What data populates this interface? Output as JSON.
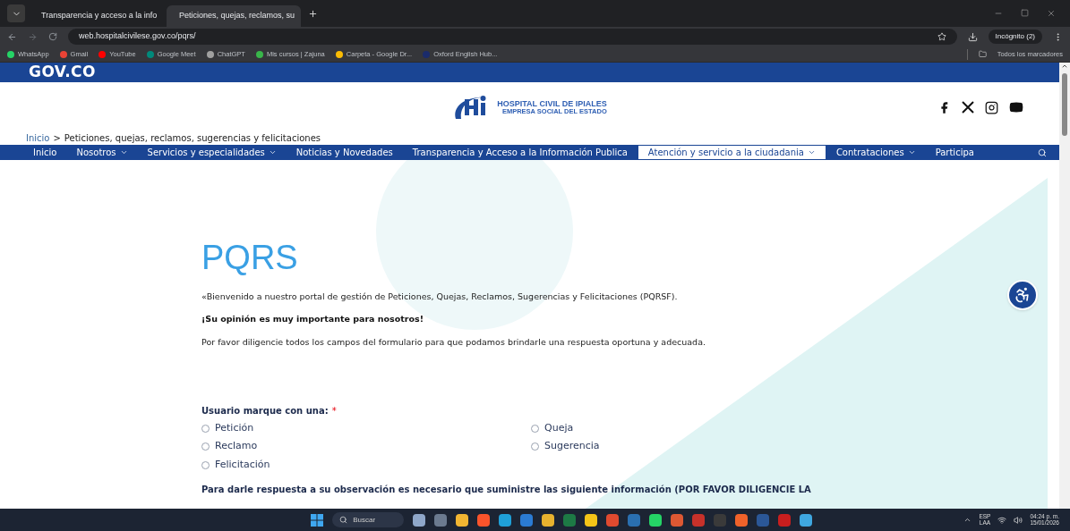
{
  "browser": {
    "tabs": [
      {
        "title": "Transparencia y acceso a la info",
        "selected": false
      },
      {
        "title": "Peticiones, quejas, reclamos, su",
        "selected": true
      }
    ],
    "url": "web.hospitalcivilese.gov.co/pqrs/",
    "profile": "Incógnito (2)",
    "bookmarks": [
      {
        "label": "WhatsApp",
        "color": "#25d366"
      },
      {
        "label": "Gmail",
        "color": "#ea4335"
      },
      {
        "label": "YouTube",
        "color": "#ff0000"
      },
      {
        "label": "Google Meet",
        "color": "#00897b"
      },
      {
        "label": "ChatGPT",
        "color": "#a0a0a0"
      },
      {
        "label": "Mis cursos | Zajuna",
        "color": "#39b54a"
      },
      {
        "label": "Carpeta - Google Dr...",
        "color": "#fbbc04"
      },
      {
        "label": "Oxford English Hub...",
        "color": "#1a2b6b"
      }
    ],
    "all_bookmarks": "Todos los marcadores"
  },
  "gov_bar": {
    "logo": "GOV.CO"
  },
  "header": {
    "hospital_name": "HOSPITAL CIVIL DE IPIALES",
    "hospital_subtitle": "EMPRESA SOCIAL DEL ESTADO"
  },
  "breadcrumb": {
    "home": "Inicio",
    "separator": ">",
    "current": "Peticiones, quejas, reclamos, sugerencias y felicitaciones"
  },
  "nav": [
    {
      "label": "Inicio",
      "dropdown": false,
      "selected": false
    },
    {
      "label": "Nosotros",
      "dropdown": true,
      "selected": false
    },
    {
      "label": "Servicios y especialidades",
      "dropdown": true,
      "selected": false
    },
    {
      "label": "Noticias y Novedades",
      "dropdown": false,
      "selected": false
    },
    {
      "label": "Transparencia y Acceso a la Información Publica",
      "dropdown": false,
      "selected": false
    },
    {
      "label": "Atención y servicio a la ciudadania",
      "dropdown": true,
      "selected": true
    },
    {
      "label": "Contrataciones",
      "dropdown": true,
      "selected": false
    },
    {
      "label": "Participa",
      "dropdown": false,
      "selected": false
    }
  ],
  "content": {
    "title": "PQRS",
    "intro": "«Bienvenido a nuestro portal de gestión de Peticiones, Quejas, Reclamos, Sugerencias y Felicitaciones (PQRSF).",
    "highlight": "¡Su opinión es muy importante para nosotros!",
    "instruction": "Por favor diligencie todos los campos del formulario para que podamos brindarle una respuesta oportuna y adecuada.",
    "form": {
      "label": "Usuario marque con una:",
      "required_mark": "*",
      "options": [
        {
          "label": "Petición",
          "selected": false
        },
        {
          "label": "Queja",
          "selected": false
        },
        {
          "label": "Reclamo",
          "selected": false
        },
        {
          "label": "Sugerencia",
          "selected": false
        },
        {
          "label": "Felicitación",
          "selected": false
        }
      ],
      "notice": "Para darle respuesta a su observación es necesario que suministre las siguiente información (POR FAVOR DILIGENCIE LA"
    }
  },
  "taskbar": {
    "search_placeholder": "Buscar",
    "language": "ESP",
    "layout": "LAA",
    "time": "04:24 p. m.",
    "date": "15/01/2026",
    "apps": [
      {
        "color": "#8fa7c9"
      },
      {
        "color": "#6b7a8f"
      },
      {
        "color": "#f2b632"
      },
      {
        "color": "#fb542b"
      },
      {
        "color": "#1fa0d8"
      },
      {
        "color": "#2b7bd3"
      },
      {
        "color": "#e8b22e"
      },
      {
        "color": "#1d7a45"
      },
      {
        "color": "#f5c518"
      },
      {
        "color": "#e04a2f"
      },
      {
        "color": "#2a6fb0"
      },
      {
        "color": "#25d366"
      },
      {
        "color": "#de5833"
      },
      {
        "color": "#c7312a"
      },
      {
        "color": "#3a3a3a"
      },
      {
        "color": "#f0622a"
      },
      {
        "color": "#2b5797"
      },
      {
        "color": "#c81e1e"
      },
      {
        "color": "#3fa7e0"
      }
    ]
  }
}
